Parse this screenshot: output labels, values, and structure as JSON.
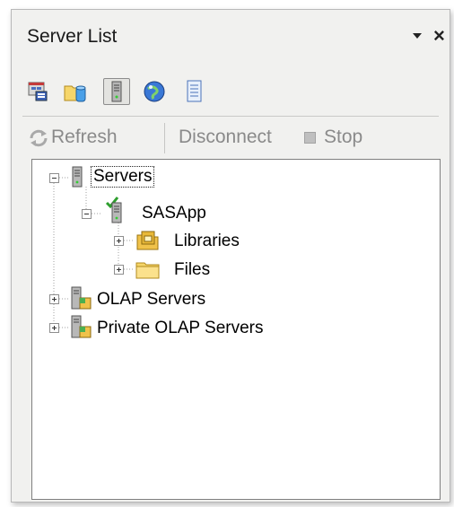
{
  "panel": {
    "title": "Server List",
    "pin_icon": "pin-dropdown-icon",
    "close_glyph": "×"
  },
  "iconbar": {
    "items": [
      {
        "name": "server-manager-icon",
        "selected": false
      },
      {
        "name": "folder-data-icon",
        "selected": false
      },
      {
        "name": "server-list-icon",
        "selected": true
      },
      {
        "name": "globe-icon",
        "selected": false
      },
      {
        "name": "document-icon",
        "selected": false
      }
    ]
  },
  "commands": {
    "refresh_label": "Refresh",
    "disconnect_label": "Disconnect",
    "stop_label": "Stop"
  },
  "tree": {
    "servers": {
      "label": "Servers",
      "expanded": true
    },
    "sasapp": {
      "label": "SASApp",
      "expanded": true,
      "connected": true
    },
    "libraries": {
      "label": "Libraries",
      "expanded": false
    },
    "files": {
      "label": "Files",
      "expanded": false
    },
    "olap": {
      "label": "OLAP Servers",
      "expanded": false
    },
    "private_olap": {
      "label": "Private OLAP Servers",
      "expanded": false
    }
  },
  "colors": {
    "panel_bg": "#f1f1ef",
    "folder_yellow": "#f6d66a",
    "check_green": "#2e9e2e",
    "server_gray": "#9a9a9a"
  }
}
